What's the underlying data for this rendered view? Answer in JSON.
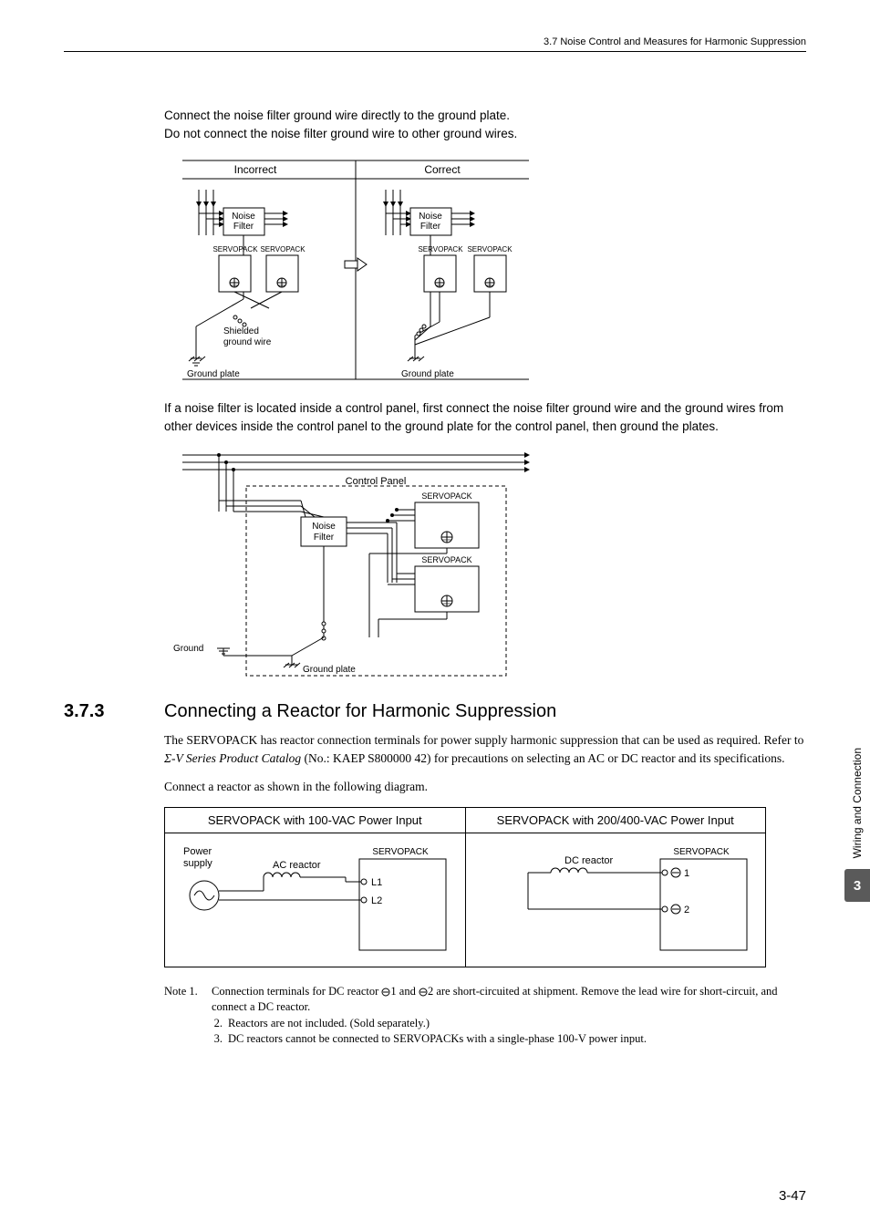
{
  "header": {
    "breadcrumb": "3.7  Noise Control and Measures for Harmonic Suppression"
  },
  "p1": "Connect the noise filter ground wire directly to the ground plate.",
  "p2": "Do not connect the noise filter ground wire to other ground wires.",
  "diagram1": {
    "col_incorrect": "Incorrect",
    "col_correct": "Correct",
    "noise_filter": "Noise\nFilter",
    "servopack": "SERVOPACK",
    "shielded_gw": "Shielded\nground wire",
    "ground_plate": "Ground plate"
  },
  "p3": "If a noise filter is located inside a control panel, first connect the noise filter ground wire and the ground wires from other devices inside the control panel to the ground plate for the control panel, then ground the plates.",
  "diagram2": {
    "control_panel": "Control Panel",
    "noise_filter": "Noise\nFilter",
    "servopack": "SERVOPACK",
    "ground": "Ground",
    "ground_plate": "Ground plate"
  },
  "section": {
    "num": "3.7.3",
    "title": "Connecting a Reactor for Harmonic Suppression"
  },
  "p4_a": "The SERVOPACK has reactor connection terminals for power supply harmonic suppression that can be used as required. Refer to ",
  "p4_i": "Σ-V Series Product Catalog",
  "p4_b": " (No.: KAEP S800000 42) for precautions on selecting an AC or DC reactor and its specifications.",
  "p5": "Connect a reactor as shown in the following diagram.",
  "reactor": {
    "head_left": "SERVOPACK with 100-VAC Power Input",
    "head_right": "SERVOPACK with 200/400-VAC Power Input",
    "power_supply": "Power\nsupply",
    "ac_reactor": "AC reactor",
    "dc_reactor": "DC reactor",
    "servopack": "SERVOPACK",
    "l1": "L1",
    "l2": "L2",
    "t1": "1",
    "t2": "2"
  },
  "notes": {
    "lead": "Note 1.",
    "n1_a": "Connection terminals for DC reactor ",
    "n1_b": "1 and ",
    "n1_c": "2 are short-circuited at shipment. Remove the lead wire for short-circuit, and connect a DC reactor.",
    "n2": "Reactors are not included. (Sold separately.)",
    "n3": "DC reactors cannot be connected to SERVOPACKs with a single-phase 100-V power input."
  },
  "side": {
    "label": "Wiring and Connection",
    "chapter": "3"
  },
  "page_num": "3-47"
}
